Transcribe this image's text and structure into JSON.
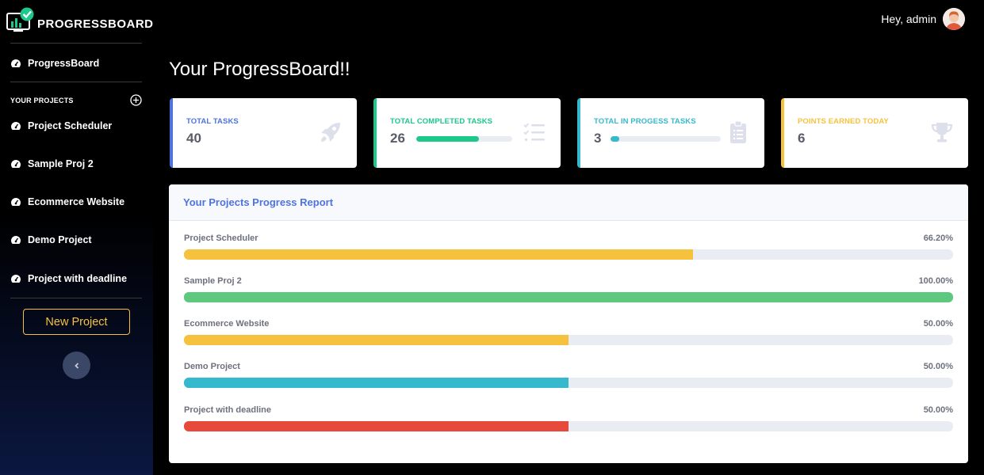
{
  "brand": {
    "name": "PROGRESSBOARD"
  },
  "sidebar": {
    "dashboard_label": "ProgressBoard",
    "section_title": "YOUR PROJECTS",
    "projects": [
      {
        "label": "Project Scheduler"
      },
      {
        "label": "Sample Proj 2"
      },
      {
        "label": "Ecommerce Website"
      },
      {
        "label": "Demo Project"
      },
      {
        "label": "Project with deadline"
      }
    ],
    "new_project_label": "New Project"
  },
  "topbar": {
    "greeting": "Hey, admin"
  },
  "page": {
    "title": "Your ProgressBoard!!"
  },
  "cards": [
    {
      "label": "TOTAL TASKS",
      "value": "40",
      "color": "#4e73df",
      "icon": "rocket-icon"
    },
    {
      "label": "TOTAL COMPLETED TASKS",
      "value": "26",
      "color": "#1cc88a",
      "icon": "tasks-icon",
      "progress": 0.65
    },
    {
      "label": "TOTAL IN PROGESS TASKS",
      "value": "3",
      "color": "#36b9cc",
      "icon": "clipboard-list-icon",
      "progress": 0.075
    },
    {
      "label": "POINTS EARNED TODAY",
      "value": "6",
      "color": "#f6c23e",
      "icon": "trophy-icon"
    }
  ],
  "report": {
    "title": "Your Projects Progress Report",
    "rows": [
      {
        "name": "Project Scheduler",
        "percent_text": "66.20%",
        "value": 66.2,
        "color": "#f6c23e"
      },
      {
        "name": "Sample Proj 2",
        "percent_text": "100.00%",
        "value": 100,
        "color": "#5dc87e"
      },
      {
        "name": "Ecommerce Website",
        "percent_text": "50.00%",
        "value": 50,
        "color": "#f6c23e"
      },
      {
        "name": "Demo Project",
        "percent_text": "50.00%",
        "value": 50,
        "color": "#36b9cc"
      },
      {
        "name": "Project with deadline",
        "percent_text": "50.00%",
        "value": 50,
        "color": "#e74a3b"
      }
    ]
  },
  "colors": {
    "accent": "#4e73df",
    "warning": "#f6c23e"
  }
}
